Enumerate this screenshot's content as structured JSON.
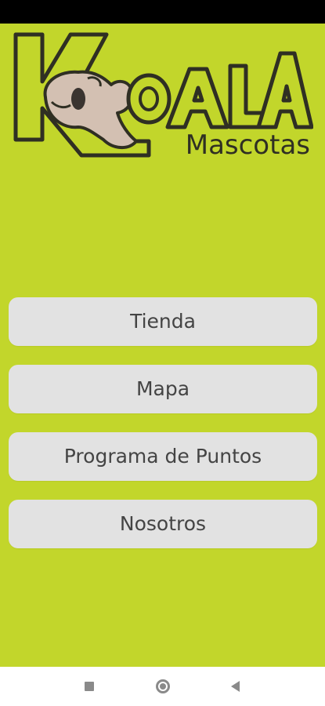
{
  "logo": {
    "brand_letters": [
      "K",
      "O",
      "A",
      "L",
      "A"
    ],
    "subtitle": "Mascotas"
  },
  "menu": {
    "items": [
      {
        "label": "Tienda"
      },
      {
        "label": "Mapa"
      },
      {
        "label": "Programa de Puntos"
      },
      {
        "label": "Nosotros"
      }
    ]
  },
  "system_nav": {
    "icons": [
      "recents-icon",
      "home-icon",
      "back-icon"
    ]
  },
  "colors": {
    "background": "#c2d62b",
    "button": "#e2e2e2",
    "button_text": "#444444",
    "logo_outline": "#2f2f23",
    "status_bar": "#000000"
  }
}
